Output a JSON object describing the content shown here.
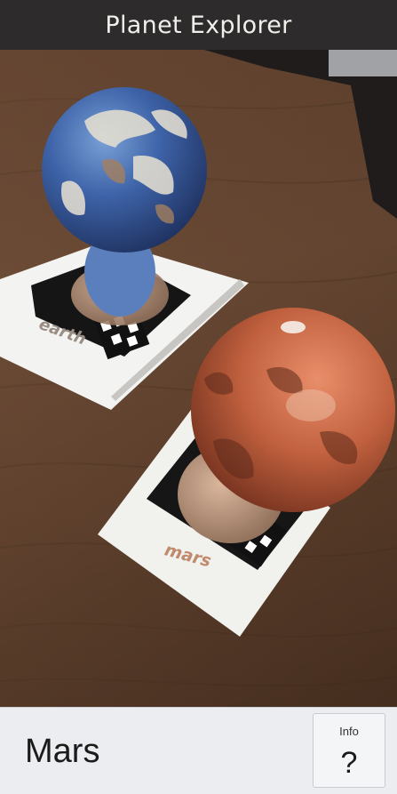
{
  "header": {
    "title": "Planet Explorer"
  },
  "cards": {
    "earth_label": "earth",
    "mars_label": "mars"
  },
  "selection": {
    "planet_name": "Mars"
  },
  "info_button": {
    "label": "Info",
    "glyph": "?"
  },
  "icons": {
    "info": "question-mark-icon"
  },
  "colors": {
    "header_bg": "#2d2b2c",
    "panel_bg": "#ecedf0",
    "mars": "#c0603e",
    "earth_ocean": "#3e63a8"
  }
}
